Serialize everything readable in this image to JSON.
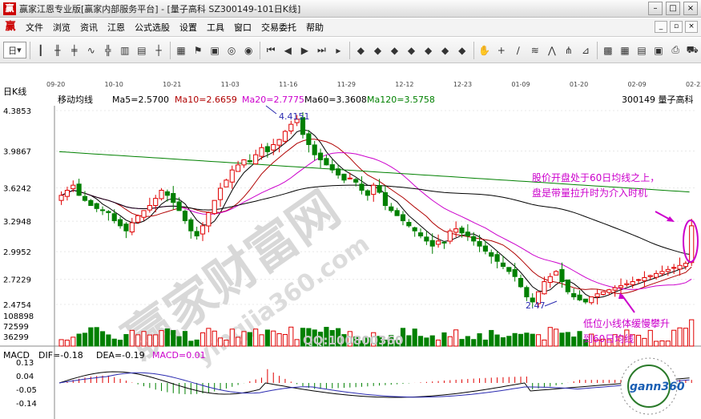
{
  "window": {
    "title": "赢家江恩专业版[赢家内部服务平台] - [量子高科   SZ300149-101日K线]",
    "logo": "赢"
  },
  "menu": {
    "logo": "赢",
    "items": [
      "文件",
      "浏览",
      "资讯",
      "江恩",
      "公式选股",
      "设置",
      "工具",
      "窗口",
      "交易委托",
      "帮助"
    ]
  },
  "toolbar": {
    "period_label": "日"
  },
  "chart": {
    "period_label": "日K线",
    "ma_title": "移动均线",
    "ma_labels": [
      {
        "text": "Ma5=2.5700",
        "color": "#000000"
      },
      {
        "text": "Ma10=2.6659",
        "color": "#b00000"
      },
      {
        "text": "Ma20=2.7775",
        "color": "#cc00cc"
      },
      {
        "text": "Ma60=3.3608",
        "color": "#000000"
      },
      {
        "text": "Ma120=3.5758",
        "color": "#008000"
      }
    ],
    "stock_label": "300149  量子高科",
    "dates": [
      "09-20",
      "10-10",
      "10-21",
      "11-03",
      "11-16",
      "11-29",
      "12-12",
      "12-23",
      "01-09",
      "01-20",
      "02-09",
      "02-22"
    ],
    "price_ticks": [
      "4.3853",
      "3.9867",
      "3.6242",
      "3.2948",
      "2.9952",
      "2.7229",
      "2.4754"
    ],
    "volume_ticks": [
      "108898",
      "72599",
      "36299"
    ],
    "high_label": "4.4151",
    "low_label": "2.47",
    "annotation_top": [
      "股价开盘处于60日均线之上，",
      "盘是带量拉升时为介入时机"
    ],
    "annotation_bottom": [
      "低位小线体缓慢攀升",
      "到60日均线"
    ],
    "watermark_qq": "QQ:100800360",
    "watermark_site": "yingjia360.com",
    "watermark_brand": "赢家财富网",
    "logo_text": "gann360",
    "colors": {
      "up": "#e00000",
      "down": "#008000",
      "ma5": "#000000",
      "ma10": "#b00000",
      "ma20": "#cc00cc",
      "ma60": "#000000",
      "ma120": "#008000",
      "annotation": "#cc00cc"
    }
  },
  "macd": {
    "title": "MACD",
    "dif": "DIF=-0.18",
    "dea": "DEA=-0.19",
    "macd": "MACD=0.01",
    "ticks": [
      "0.13",
      "0.04",
      "-0.05",
      "-0.14"
    ]
  },
  "chart_data": {
    "type": "candlestick",
    "xaxis_ticks": [
      "09-20",
      "10-10",
      "10-21",
      "11-03",
      "11-16",
      "11-29",
      "12-12",
      "12-23",
      "01-09",
      "01-20",
      "02-09",
      "02-22"
    ],
    "ylim": [
      2.4754,
      4.3853
    ],
    "yticks": [
      4.3853,
      3.9867,
      3.6242,
      3.2948,
      2.9952,
      2.7229,
      2.4754
    ],
    "close_series": [
      3.55,
      3.6,
      3.65,
      3.55,
      3.5,
      3.45,
      3.42,
      3.4,
      3.38,
      3.3,
      3.25,
      3.2,
      3.28,
      3.35,
      3.4,
      3.45,
      3.52,
      3.6,
      3.55,
      3.48,
      3.4,
      3.3,
      3.2,
      3.15,
      3.25,
      3.38,
      3.5,
      3.62,
      3.7,
      3.8,
      3.85,
      3.9,
      3.88,
      3.95,
      4.02,
      3.98,
      4.05,
      4.1,
      4.18,
      4.25,
      4.3,
      4.15,
      4.05,
      3.95,
      3.9,
      3.85,
      3.8,
      3.75,
      3.7,
      3.72,
      3.68,
      3.6,
      3.55,
      3.65,
      3.58,
      3.45,
      3.4,
      3.35,
      3.3,
      3.25,
      3.2,
      3.15,
      3.1,
      3.05,
      3.1,
      3.08,
      3.2,
      3.22,
      3.18,
      3.15,
      3.1,
      3.05,
      3.0,
      2.95,
      2.9,
      2.85,
      2.8,
      2.75,
      2.65,
      2.55,
      2.5,
      2.6,
      2.7,
      2.75,
      2.8,
      2.7,
      2.6,
      2.55,
      2.52,
      2.5,
      2.55,
      2.58,
      2.6,
      2.62,
      2.64,
      2.66,
      2.68,
      2.7,
      2.72,
      2.74,
      2.76,
      2.78,
      2.8,
      2.82,
      2.84,
      2.86,
      2.88,
      3.25
    ],
    "annotations": {
      "high": 4.4151,
      "low": 2.47
    }
  }
}
